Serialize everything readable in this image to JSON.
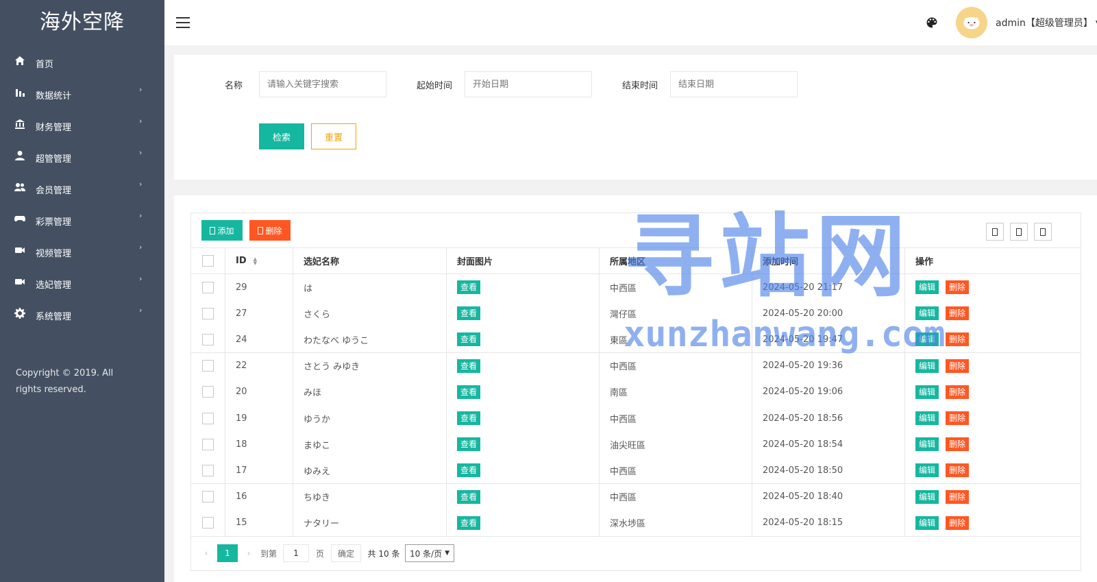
{
  "sidebar": {
    "logo": "海外空降",
    "items": [
      {
        "label": "首页",
        "icon": "home-icon",
        "has_arrow": false
      },
      {
        "label": "数据统计",
        "icon": "bar-chart-icon",
        "has_arrow": true
      },
      {
        "label": "财务管理",
        "icon": "bank-icon",
        "has_arrow": true
      },
      {
        "label": "超管管理",
        "icon": "user-icon",
        "has_arrow": true
      },
      {
        "label": "会员管理",
        "icon": "users-icon",
        "has_arrow": true
      },
      {
        "label": "彩票管理",
        "icon": "gamepad-icon",
        "has_arrow": true
      },
      {
        "label": "视频管理",
        "icon": "video-camera-icon",
        "has_arrow": true
      },
      {
        "label": "选妃管理",
        "icon": "video-camera-icon",
        "has_arrow": true
      },
      {
        "label": "系统管理",
        "icon": "gear-icon",
        "has_arrow": true
      }
    ],
    "arrow": "›",
    "copyright": "Copyright © 2019. All rights reserved."
  },
  "header": {
    "user": "admin【超级管理员】",
    "caret": "▼"
  },
  "search": {
    "name_label": "名称",
    "name_placeholder": "请输入关键字搜索",
    "start_label": "起始时间",
    "start_placeholder": "开始日期",
    "end_label": "结束时间",
    "end_placeholder": "结束日期",
    "search_button": "检索",
    "reset_button": "重置"
  },
  "toolbar": {
    "add_button": "添加",
    "delete_button": "删除"
  },
  "table": {
    "columns": [
      "ID",
      "选妃名称",
      "封面图片",
      "所属地区",
      "添加时间",
      "操作"
    ],
    "view_label": "查看",
    "edit_label": "编辑",
    "delete_label": "删除",
    "rows": [
      {
        "id": "29",
        "name": "は",
        "region": "中西區",
        "time": "2024-05-20 21:17"
      },
      {
        "id": "27",
        "name": "さくら",
        "region": "灣仔區",
        "time": "2024-05-20 20:00"
      },
      {
        "id": "24",
        "name": "わたなべ ゆうこ",
        "region": "東區",
        "time": "2024-05-20 19:47"
      },
      {
        "id": "22",
        "name": "さとう みゆき",
        "region": "中西區",
        "time": "2024-05-20 19:36"
      },
      {
        "id": "20",
        "name": "みほ",
        "region": "南區",
        "time": "2024-05-20 19:06"
      },
      {
        "id": "19",
        "name": "ゆうか",
        "region": "中西區",
        "time": "2024-05-20 18:56"
      },
      {
        "id": "18",
        "name": "まゆこ",
        "region": "油尖旺區",
        "time": "2024-05-20 18:54"
      },
      {
        "id": "17",
        "name": "ゆみえ",
        "region": "中西區",
        "time": "2024-05-20 18:50"
      },
      {
        "id": "16",
        "name": "ちゆき",
        "region": "中西區",
        "time": "2024-05-20 18:40"
      },
      {
        "id": "15",
        "name": "ナタリー",
        "region": "深水埗區",
        "time": "2024-05-20 18:15"
      }
    ]
  },
  "pagination": {
    "current_page": "1",
    "goto_label": "到第",
    "page_input": "1",
    "page_unit": "页",
    "confirm": "确定",
    "total": "共 10 条",
    "per_page": "10 条/页"
  },
  "watermark": {
    "big": "寻站网",
    "small": "xunzhanwang.com"
  },
  "colors": {
    "sidebar_bg": "#445062",
    "accent": "#16b7a0",
    "danger": "#ff5722",
    "warning": "#f4a300"
  }
}
